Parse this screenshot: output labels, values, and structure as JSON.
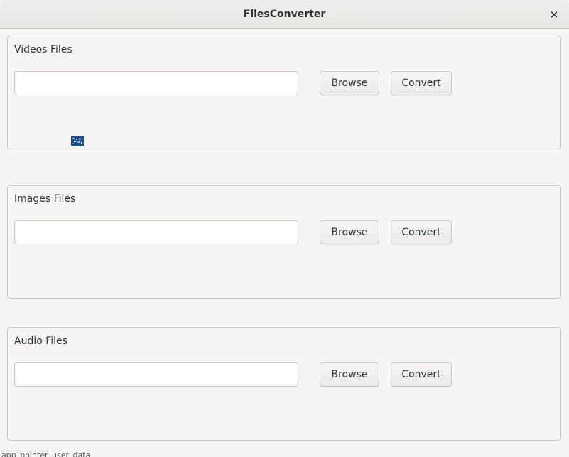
{
  "window": {
    "title": "FilesConverter",
    "close_icon": "close-icon"
  },
  "groups": [
    {
      "label": "Videos Files",
      "input_value": "",
      "browse_label": "Browse",
      "convert_label": "Convert"
    },
    {
      "label": "Images Files",
      "input_value": "",
      "browse_label": "Browse",
      "convert_label": "Convert"
    },
    {
      "label": "Audio Files",
      "input_value": "",
      "browse_label": "Browse",
      "convert_label": "Convert"
    }
  ],
  "footer": {
    "text": "app_pointer_user_data"
  },
  "colors": {
    "background": "#f6f5f4",
    "border": "#cdc7c2",
    "text": "#2e3436",
    "glitch_icon": "#1c4f8a"
  }
}
